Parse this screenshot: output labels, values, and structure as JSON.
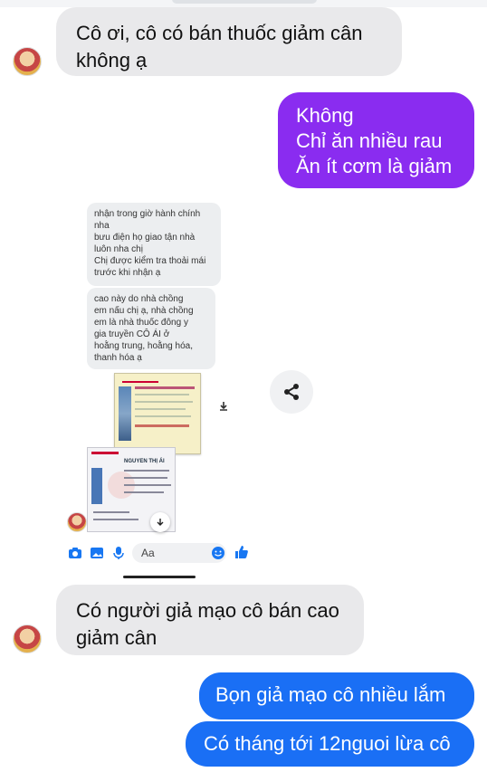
{
  "messages": [
    {
      "side": "in",
      "lines": [
        "Cô ơi, cô có bán thuốc giảm cân",
        "không ạ"
      ]
    },
    {
      "side": "out",
      "color": "#8a2cf0",
      "lines": [
        "Không",
        "Chỉ ăn nhiều rau",
        "Ăn ít cơm là giảm"
      ]
    },
    {
      "side": "in",
      "lines": [
        "Có người giả mạo cô bán cao",
        "giảm cân"
      ]
    },
    {
      "side": "out",
      "color": "#1a6ff5",
      "lines": [
        "Bọn giả mạo cô nhiều lắm"
      ]
    },
    {
      "side": "out",
      "color": "#1a6ff5",
      "lines": [
        "Có tháng tới 12nguoi lừa cô"
      ]
    }
  ],
  "embedded": {
    "bubble1": [
      "nhận trong giờ hành chính",
      "nha",
      "bưu điện họ giao tận nhà",
      "luôn nha chị",
      "Chị được kiểm tra thoải mái",
      "trước khi nhận ạ"
    ],
    "bubble2": [
      "cao này do nhà chồng",
      "em nấu chị ạ, nhà chồng",
      "em là nhà thuốc đông y",
      "gia truyền CÔ ÁI ở",
      "hoằng trung, hoằng hóa,",
      "thanh hóa ạ"
    ],
    "card2_name": "NGUYEN THỊ ÁI",
    "composer_placeholder": "Aa"
  },
  "icons": {
    "share": "share-icon",
    "camera": "camera-icon",
    "image": "image-icon",
    "mic": "microphone-icon",
    "emoji": "emoji-icon",
    "like": "thumbs-up-icon",
    "download": "download-icon",
    "scroll_down": "arrow-down-icon"
  },
  "colors": {
    "incoming_bubble": "#e9e9eb",
    "purple_bubble": "#8a2cf0",
    "blue_bubble": "#1a6ff5",
    "messenger_blue": "#1877f2"
  }
}
